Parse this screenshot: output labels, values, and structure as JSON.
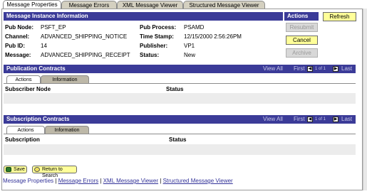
{
  "tabs": [
    "Message Properties",
    "Message Errors",
    "XML Message Viewer",
    "Structured Message Viewer"
  ],
  "instance": {
    "header": "Message Instance Information",
    "left": [
      {
        "label": "Pub Node:",
        "value": "PSFT_EP"
      },
      {
        "label": "Channel:",
        "value": "ADVANCED_SHIPPING_NOTICE"
      },
      {
        "label": "Pub ID:",
        "value": "14"
      },
      {
        "label": "Message:",
        "value": "ADVANCED_SHIPPING_RECEIPT"
      }
    ],
    "right": [
      {
        "label": "Pub Process:",
        "value": "PSAMD"
      },
      {
        "label": "Time Stamp:",
        "value": "12/15/2000  2:56:26PM"
      },
      {
        "label": "Publisher:",
        "value": "VP1"
      },
      {
        "label": "Status:",
        "value": "New"
      }
    ]
  },
  "actions": {
    "header": "Actions",
    "resubmit": "Resubmit",
    "cancel": "Cancel",
    "archive": "Archive"
  },
  "refresh": "Refresh",
  "publication": {
    "header": "Publication Contracts",
    "view_all": "View All",
    "first": "First",
    "range": "1 of 1",
    "last": "Last",
    "tabs": [
      "Actions",
      "Information"
    ],
    "col1": "Subscriber Node",
    "col2": "Status"
  },
  "subscription": {
    "header": "Subscription Contracts",
    "view_all": "View All",
    "first": "First",
    "range": "1 of 1",
    "last": "Last",
    "tabs": [
      "Actions",
      "Information"
    ],
    "col1": "Subscription",
    "col2": "Status"
  },
  "bottom": {
    "save": "Save",
    "return": "Return to Search"
  },
  "links": [
    "Message Properties",
    "Message Errors",
    "XML Message Viewer",
    "Structured Message Viewer"
  ],
  "link_separator": " | "
}
